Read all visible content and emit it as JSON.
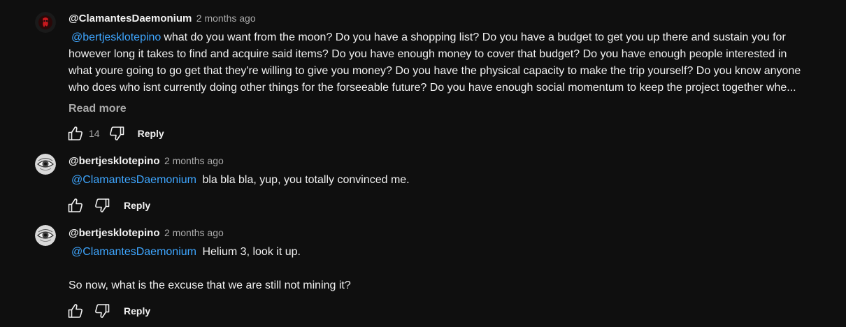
{
  "comments": [
    {
      "author": "@ClamantesDaemonium",
      "time": "2 months ago",
      "avatar_icon": "red-logo-avatar",
      "mention": "@bertjesklotepino",
      "lines": [
        "what do you want from the moon? Do you have a shopping list? Do you have a budget to get you up there and sustain you for",
        "however long it takes to find and acquire said items? Do you have enough money to cover that budget? Do you have enough people interested in",
        "what youre going to go get that they're willing to give you money? Do you have the physical capacity to make the trip yourself? Do you know anyone",
        "who does who isnt currently doing other things for the forseeable future? Do you have enough social momentum to keep the project together whe..."
      ],
      "read_more": "Read more",
      "likes": "14",
      "reply_label": "Reply"
    },
    {
      "author": "@bertjesklotepino",
      "time": "2 months ago",
      "avatar_icon": "eye-drawing-avatar",
      "mention": "@ClamantesDaemonium",
      "text": "bla bla bla, yup, you totally convinced me.",
      "reply_label": "Reply"
    },
    {
      "author": "@bertjesklotepino",
      "time": "2 months ago",
      "avatar_icon": "eye-drawing-avatar",
      "mention": "@ClamantesDaemonium",
      "text": "Helium 3, look it up.",
      "text2": "So now, what is the excuse that we are still not mining it?",
      "reply_label": "Reply"
    }
  ],
  "colors": {
    "background": "#0f0f0f",
    "text": "#f1f1f1",
    "secondary": "#aaaaaa",
    "mention": "#3ea6ff"
  }
}
